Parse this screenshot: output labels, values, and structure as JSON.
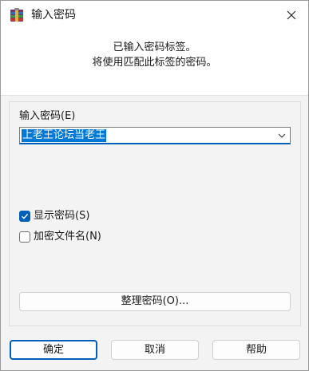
{
  "window": {
    "title": "输入密码",
    "close_icon": "close-icon",
    "app_icon": "winrar-icon"
  },
  "header": {
    "line1": "已输入密码标签。",
    "line2": "将使用匹配此标签的密码。"
  },
  "password": {
    "label": "输入密码(E)",
    "value": "上老王论坛当老王",
    "dropdown_icon": "chevron-down-icon"
  },
  "options": {
    "show_password": {
      "label": "显示密码(S)",
      "checked": true
    },
    "encrypt_filenames": {
      "label": "加密文件名(N)",
      "checked": false
    }
  },
  "manage_button": "整理密码(O)...",
  "buttons": {
    "ok": "确定",
    "cancel": "取消",
    "help": "帮助"
  },
  "colors": {
    "accent": "#005fb8",
    "selection": "#0078d7"
  }
}
